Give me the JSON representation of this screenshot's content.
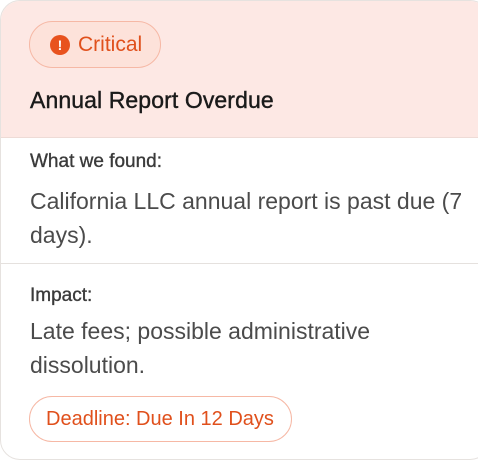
{
  "alert": {
    "severity": "Critical",
    "severity_icon": "exclamation-circle-icon",
    "title": "Annual Report Overdue",
    "found_label": "What we found:",
    "found_text": "California LLC annual report is past due (7 days).",
    "impact_label": "Impact:",
    "impact_text": "Late fees; possible administrative dissolution.",
    "deadline": "Deadline: Due In 12 Days"
  },
  "colors": {
    "header_bg": "#fde8e4",
    "accent": "#e0501c",
    "badge_border": "#f6b8a5"
  }
}
